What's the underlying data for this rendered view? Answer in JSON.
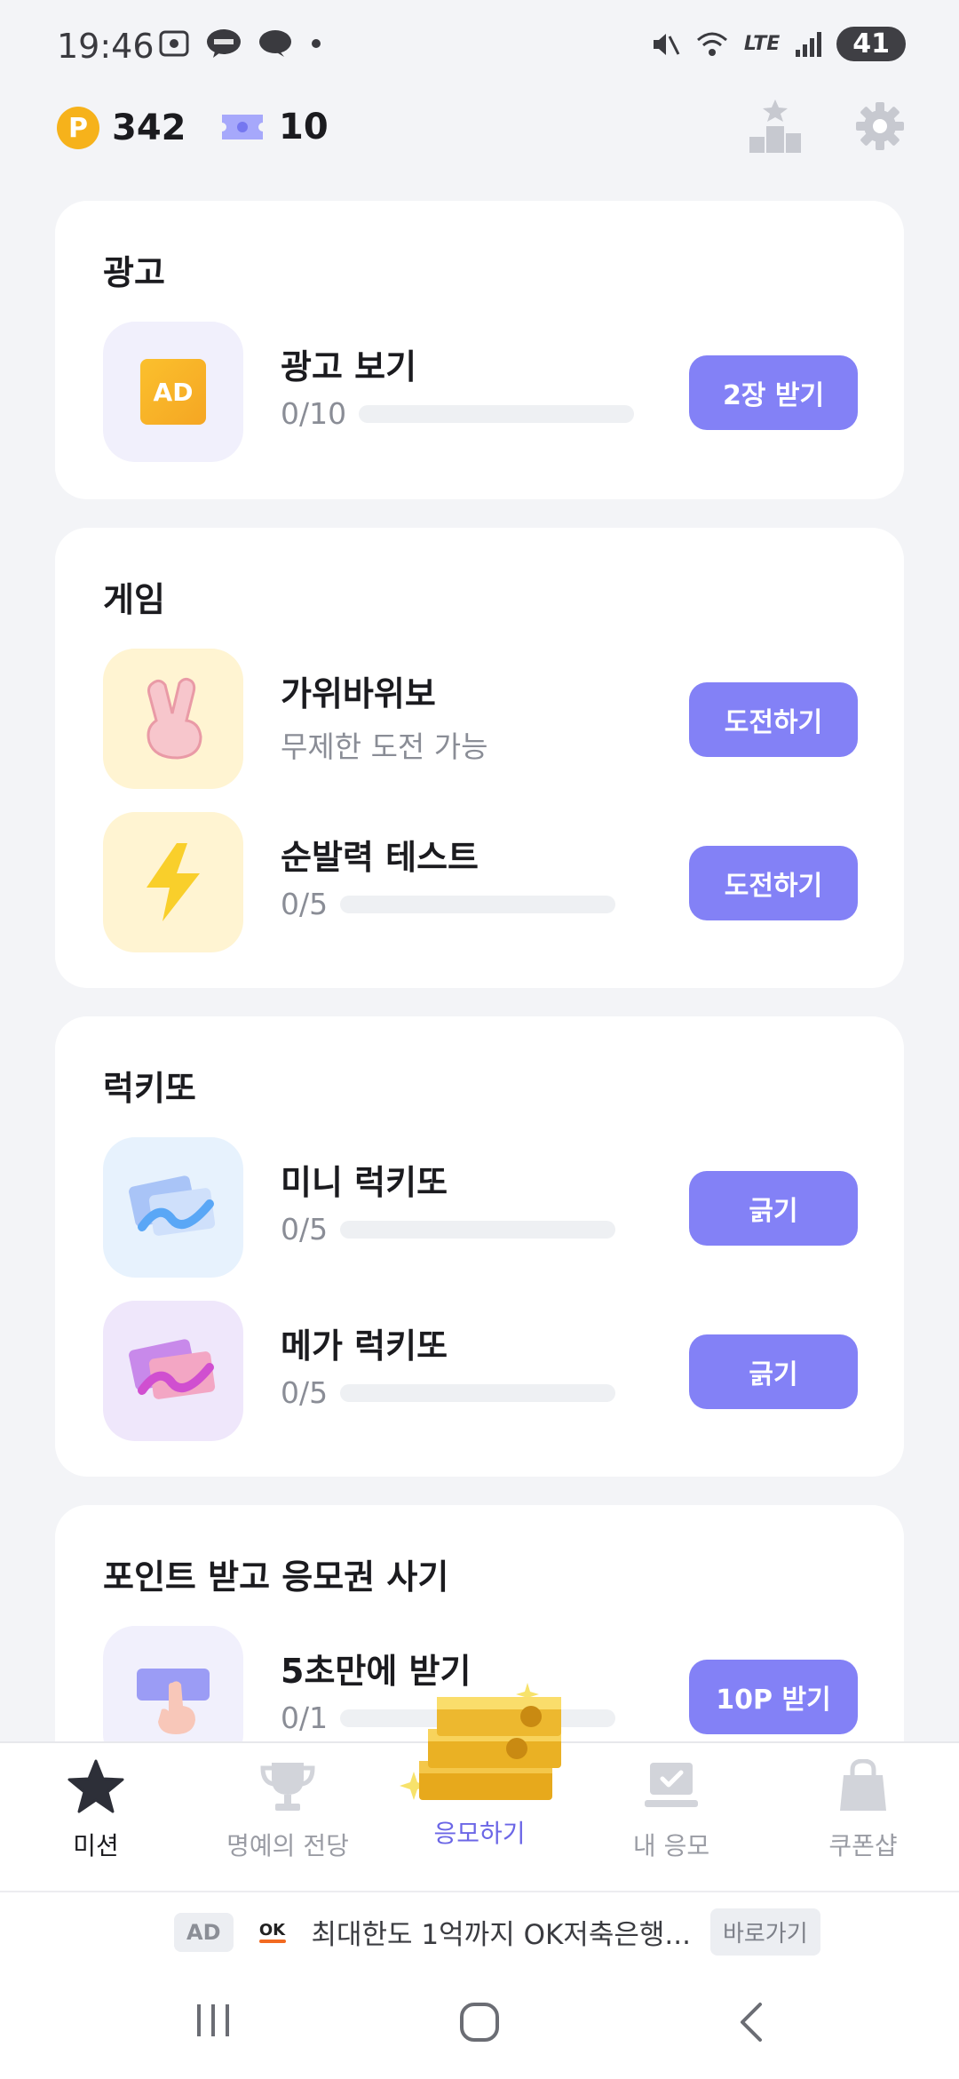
{
  "status": {
    "time": "19:46",
    "battery": "41",
    "network": "LTE"
  },
  "topbar": {
    "points": "342",
    "tickets": "10",
    "point_symbol": "P"
  },
  "sections": {
    "ad": {
      "title": "광고",
      "rows": [
        {
          "title": "광고 보기",
          "progress_text": "0/10",
          "progress": 0,
          "button": "2장 받기",
          "thumb_text": "AD"
        }
      ]
    },
    "game": {
      "title": "게임",
      "rows": [
        {
          "title": "가위바위보",
          "subtitle": "무제한 도전 가능",
          "button": "도전하기"
        },
        {
          "title": "순발력 테스트",
          "progress_text": "0/5",
          "progress": 0,
          "button": "도전하기"
        }
      ]
    },
    "lotto": {
      "title": "럭키또",
      "rows": [
        {
          "title": "미니 럭키또",
          "progress_text": "0/5",
          "progress": 0,
          "button": "긁기"
        },
        {
          "title": "메가 럭키또",
          "progress_text": "0/5",
          "progress": 0,
          "button": "긁기"
        }
      ]
    },
    "points": {
      "title": "포인트 받고 응모권 사기",
      "rows": [
        {
          "title": "5초만에 받기",
          "progress_text": "0/1",
          "progress": 0,
          "button": "10P 받기"
        }
      ]
    }
  },
  "tabs": [
    {
      "label": "미션",
      "icon": "star-icon"
    },
    {
      "label": "명예의 전당",
      "icon": "trophy-icon"
    },
    {
      "label": "응모하기",
      "icon": "money-stack-icon"
    },
    {
      "label": "내 응모",
      "icon": "laptop-check-icon"
    },
    {
      "label": "쿠폰샵",
      "icon": "shopping-bag-icon"
    }
  ],
  "ad_banner": {
    "badge": "AD",
    "logo_text": "OK",
    "text": "최대한도 1억까지 OK저축은행...",
    "link": "바로가기"
  },
  "colors": {
    "accent": "#8381f6",
    "point_coin": "#f6b21b",
    "background": "#f3f4f7"
  }
}
